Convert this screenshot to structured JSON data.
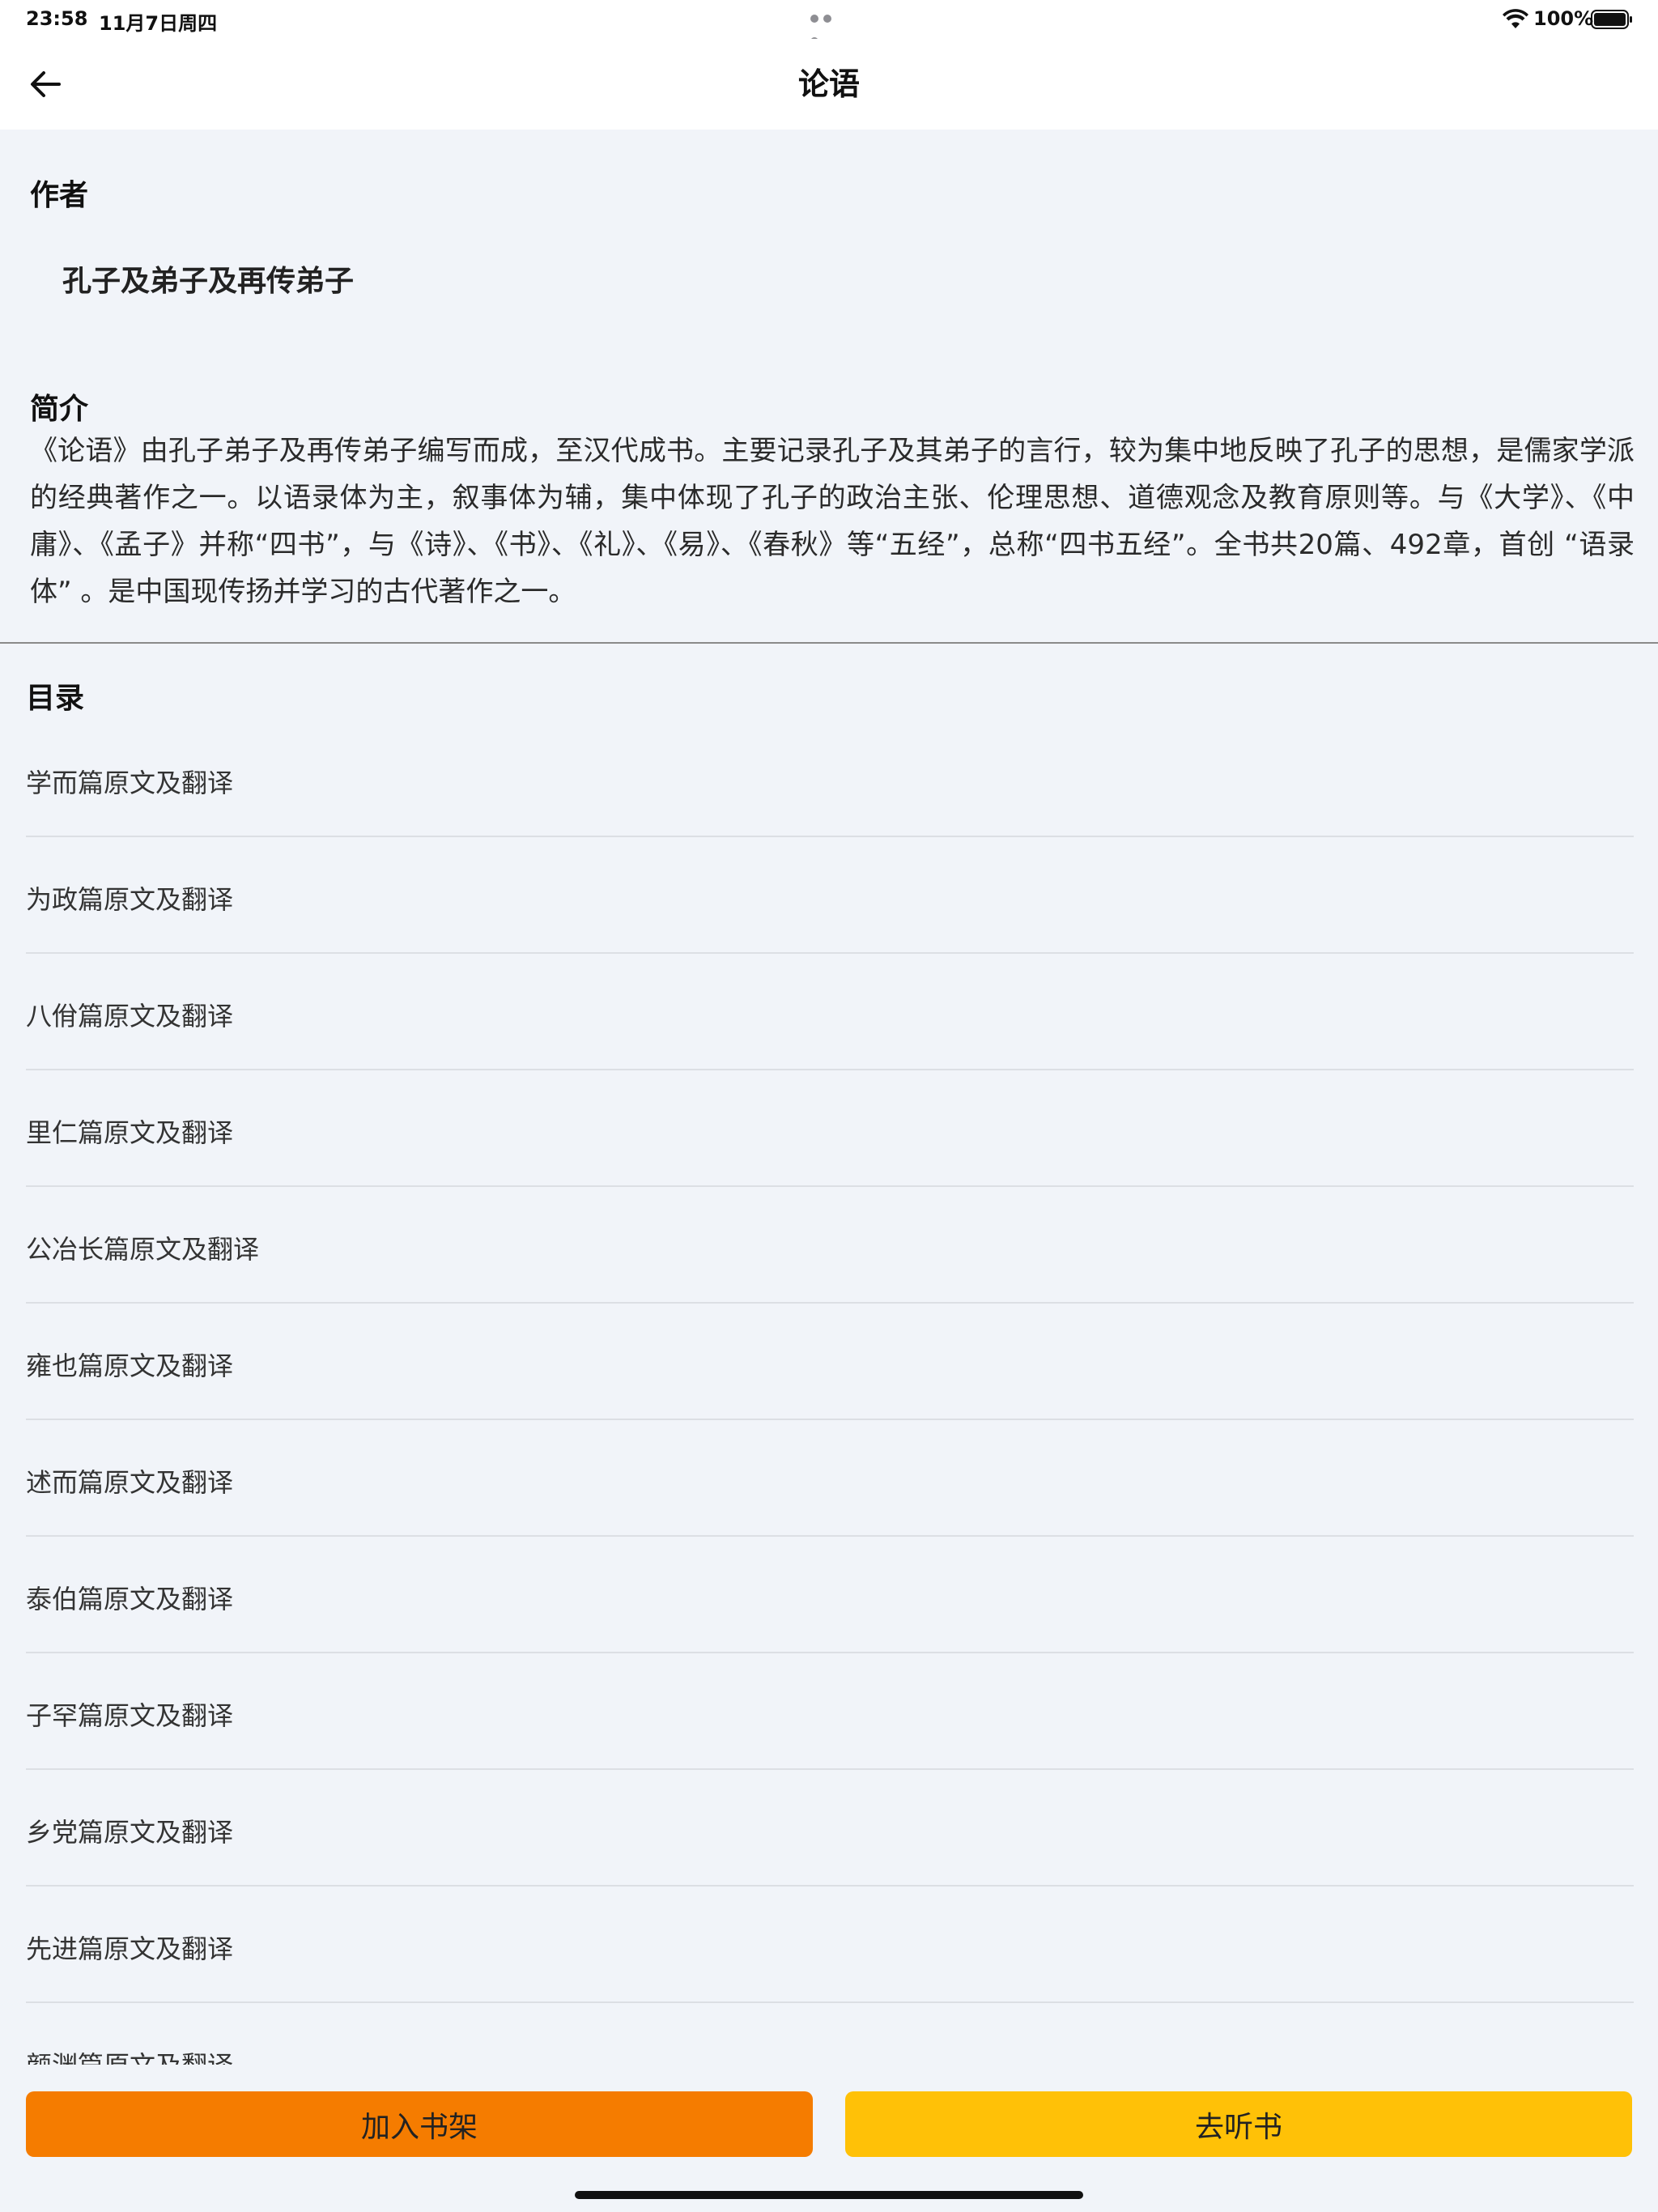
{
  "status_bar": {
    "time": "23:58",
    "date": "11月7日周四",
    "battery_percent": "100%",
    "battery_level": 1.0
  },
  "nav": {
    "title": "论语",
    "back_icon": "arrow-left-icon"
  },
  "author": {
    "heading": "作者",
    "name": "孔子及弟子及再传弟子"
  },
  "intro": {
    "heading": "简介",
    "text": "《论语》由孔子弟子及再传弟子编写而成，至汉代成书。主要记录孔子及其弟子的言行，较为集中地反映了孔子的思想，是儒家学派的经典著作之一。以语录体为主，叙事体为辅，集中体现了孔子的政治主张、伦理思想、道德观念及教育原则等。与《大学》、《中庸》、《孟子》并称“四书”，与《诗》、《书》、《礼》、《易》、《春秋》等“五经”，总称“四书五经”。全书共20篇、492章，首创 “语录体” 。是中国现传扬并学习的古代著作之一。"
  },
  "toc": {
    "heading": "目录",
    "items": [
      "学而篇原文及翻译",
      "为政篇原文及翻译",
      "八佾篇原文及翻译",
      "里仁篇原文及翻译",
      "公冶长篇原文及翻译",
      "雍也篇原文及翻译",
      "述而篇原文及翻译",
      "泰伯篇原文及翻译",
      "子罕篇原文及翻译",
      "乡党篇原文及翻译",
      "先进篇原文及翻译",
      "颜渊篇原文及翻译"
    ]
  },
  "actions": {
    "add_to_shelf": "加入书架",
    "listen": "去听书"
  },
  "colors": {
    "add_to_shelf_bg": "#f57c00",
    "listen_bg": "#ffc107",
    "page_bg": "#f1f4f9"
  }
}
